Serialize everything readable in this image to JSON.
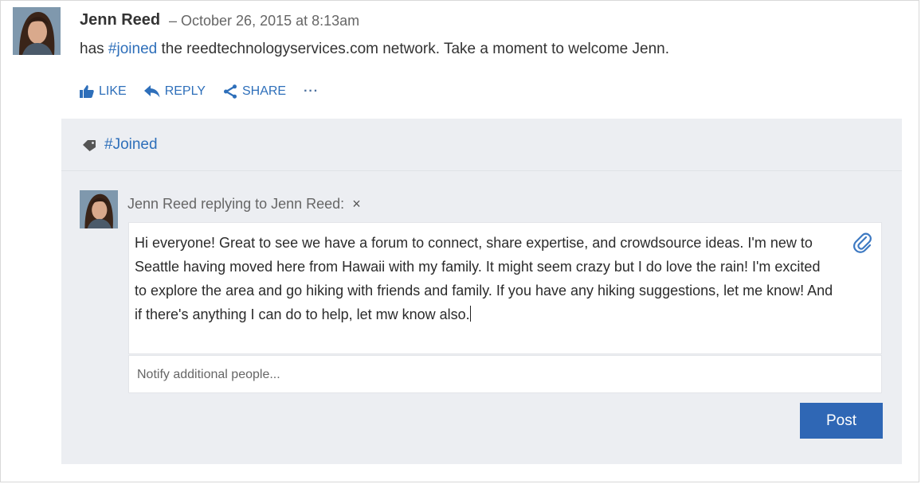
{
  "post": {
    "author": "Jenn Reed",
    "meta": "– October 26, 2015 at 8:13am",
    "body_prefix": "has ",
    "body_tag": "#joined",
    "body_suffix": " the reedtechnologyservices.com network. Take a moment to welcome Jenn."
  },
  "actions": {
    "like": "LIKE",
    "reply": "REPLY",
    "share": "SHARE",
    "more": "···"
  },
  "tag_row": {
    "tag": "#Joined"
  },
  "reply": {
    "header": "Jenn Reed replying to Jenn Reed:",
    "close": "×",
    "message": "Hi everyone! Great to see we have a forum to connect, share expertise, and crowdsource ideas. I'm new to Seattle having moved here from Hawaii with my family. It might seem crazy but I do love the rain! I'm excited to explore the area and go hiking with friends and family. If you have any hiking suggestions, let me know! And if there's anything I can do to help, let mw know also.",
    "notify_placeholder": "Notify additional people...",
    "post_label": "Post"
  },
  "icons": {
    "like": "thumbs-up-icon",
    "reply": "reply-arrow-icon",
    "share": "share-icon",
    "tag": "tag-icon",
    "attach": "paperclip-icon"
  },
  "colors": {
    "link": "#2e6fba",
    "panel_bg": "#eceef2",
    "post_button": "#2f67b5"
  }
}
